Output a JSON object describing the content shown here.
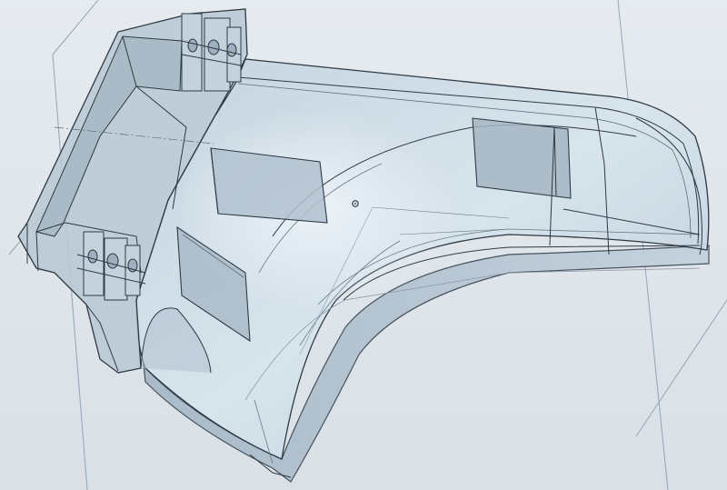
{
  "viewport": {
    "background_top": "#e6ebef",
    "background_bottom": "#d9e0e6"
  },
  "palette": {
    "edge": "#2e3a45",
    "edge_light": "#6a7a88",
    "face_light": "#d2dde6",
    "face_mid": "#b9c8d4",
    "face_dark": "#9eb0bf",
    "hidden": "#8d9cab",
    "plane_line": "#7f95aa",
    "highlight": "#f0f6fb"
  },
  "model": {
    "name_icon": "cad-part-icon",
    "view": "isometric",
    "render": "shaded-with-edges"
  }
}
